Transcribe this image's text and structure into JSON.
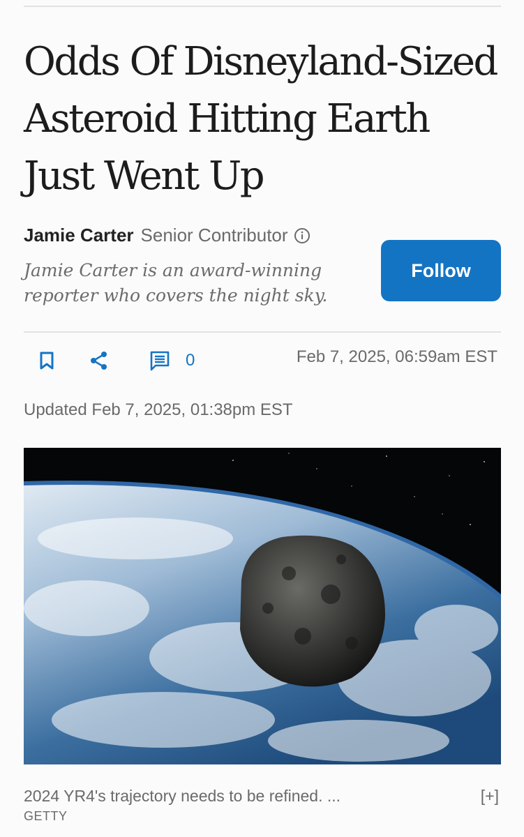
{
  "article": {
    "headline": "Odds Of Disneyland-Sized Asteroid Hitting Earth Just Went Up"
  },
  "author": {
    "name": "Jamie Carter",
    "role": "Senior Contributor",
    "bio": "Jamie Carter is an award-winning reporter who covers the night sky.",
    "follow_label": "Follow"
  },
  "actions": {
    "comment_count": "0",
    "bookmark_icon": "bookmark-icon",
    "share_icon": "share-icon",
    "comment_icon": "comment-icon"
  },
  "dates": {
    "published": "Feb 7, 2025,  06:59am EST",
    "updated": "Updated Feb 7, 2025, 01:38pm EST"
  },
  "image": {
    "caption": "2024 YR4's trajectory needs to be refined. ...",
    "credit": "GETTY",
    "expand_label": "[+]"
  },
  "colors": {
    "accent": "#1474c4",
    "text": "#222222",
    "muted": "#6a6a6a",
    "background": "#fbfbfb"
  }
}
